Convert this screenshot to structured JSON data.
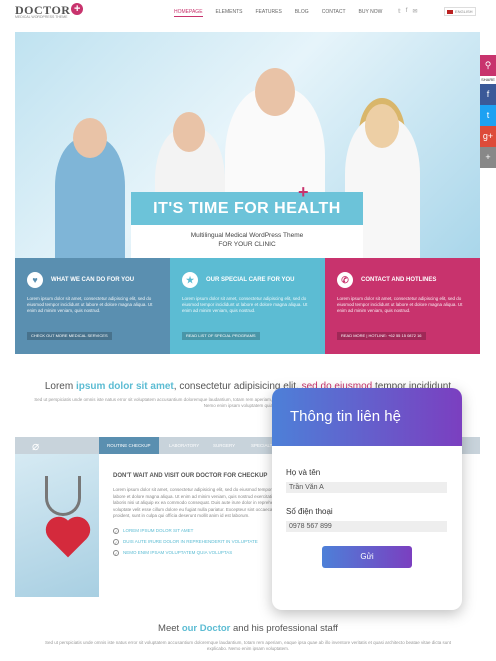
{
  "header": {
    "logo": "DOCTOR",
    "logo_sub": "MEDICAL WORDPRESS THEME",
    "nav": [
      "HOMEPAGE",
      "ELEMENTS",
      "FEATURES",
      "BLOG",
      "CONTACT",
      "BUY NOW"
    ],
    "language": "ENGLISH"
  },
  "hero": {
    "banner": "IT'S TIME FOR HEALTH CARE",
    "sub1": "Multilingual Medical WordPress Theme",
    "sub2": "FOR YOUR CLINIC"
  },
  "features": [
    {
      "title": "WHAT WE CAN DO FOR YOU",
      "text": "Lorem ipsum dolor sit amet, consectetur adipiscing elit, sed do eiusmod tempor incididunt ut labore et dolore magna aliqua. Ut enim ad minim veniam, quis nostrud.",
      "button": "CHECK OUT MORE MEDICAL SERVICES"
    },
    {
      "title": "OUR SPECIAL CARE FOR YOU",
      "text": "Lorem ipsum dolor sit amet, consectetur adipiscing elit, sed do eiusmod tempor incididunt ut labore et dolore magna aliqua. Ut enim ad minim veniam, quis nostrud.",
      "button": "READ LIST OF SPECIAL PROGRAMS"
    },
    {
      "title": "CONTACT AND HOTLINES",
      "text": "Lorem ipsum dolor sit amet, consectetur adipiscing elit, sed do eiusmod tempor incididunt ut labore et dolore magna aliqua. Ut enim ad minim veniam, quis nostrud.",
      "button": "READ MORE | HOTLINE: +62 55 15 0872 16"
    }
  ],
  "lorem_title": {
    "a": "Lorem ",
    "b": "ipsum dolor sit amet",
    "c": ", consectetur adipisicing elit, ",
    "d": "sed do eiusmod",
    "e": " tempor incididunt"
  },
  "lorem_p": "Sed ut perspiciatis unde omnis iste natus error sit voluptatem accusantium doloremque laudantium, totam rem aperiam, eaque ipsa quae ab illo inventore veritatis et quasi architecto beatae vitae dicta sunt explicabo. Nemo enim ipsam voluptatem quia voluptas.",
  "tabs": [
    "ROUTINE CHECKUP",
    "LABORATORY",
    "SURGERY",
    "SPECIALTY"
  ],
  "tab_content": {
    "heading": "DON'T WAIT AND VISIT OUR DOCTOR FOR CHECKUP",
    "text": "Lorem ipsum dolor sit amet, consectetur adipisicing elit, sed do eiusmod tempor incididunt ut labore et dolore magna aliqua. Ut enim ad minim veniam, quis nostrud exercitation ullamco laboris nisi ut aliquip ex ea commodo consequat. Duis aute irure dolor in reprehenderit in voluptate velit esse cillum dolore eu fugiat nulla pariatur. Excepteur sint occaecat cupidatat non proident, sunt in culpa qui officia deserunt mollit anim id est laborum.",
    "checks": [
      "LOREM IPSUM DOLOR SIT AMET",
      "DUIS AUTE IRURE DOLOR IN REPREHENDERIT IN VOLUPTATE",
      "NEMO ENIM IPSAM VOLUPTATEM QUIA VOLUPTAS"
    ]
  },
  "meet": {
    "a": "Meet ",
    "b": "our Doctor",
    "c": " and his professional staff"
  },
  "meet_p": "Sed ut perspiciatis unde omnis iste natus error sit voluptatem accusantium doloremque laudantium, totam rem aperiam, eaque ipsa quae ab illo inventore veritatis et quasi architecto beatae vitae dicta sunt explicabo. Nemo enim ipsam voluptatem.",
  "share": {
    "label": "SHARE"
  },
  "modal": {
    "title": "Thông tin liên hệ",
    "name_label": "Họ và tên",
    "name_value": "Trần Văn A",
    "phone_label": "Số điện thoại",
    "phone_value": "0978 567 899",
    "submit": "Gửi"
  }
}
